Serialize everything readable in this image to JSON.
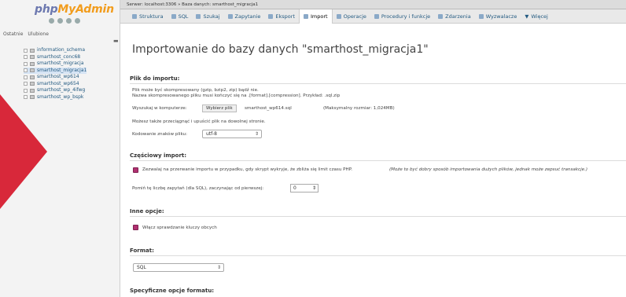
{
  "sidebar": {
    "logo_part1": "php",
    "logo_part2": "MyAdmin",
    "tabs": [
      "Ostatnie",
      "Ulubione"
    ],
    "databases": [
      "information_schema",
      "smarthost_conc68",
      "smarthost_migracja",
      "smarthost_migracja1",
      "smarthost_wp614",
      "smarthost_wp654",
      "smarthost_wp_4ifwg",
      "smarthost_wp_bspk"
    ]
  },
  "topbar": {
    "text": "Serwer: localhost:3306 » Baza danych: smarthost_migracja1"
  },
  "tabs": [
    "Struktura",
    "SQL",
    "Szukaj",
    "Zapytanie",
    "Eksport",
    "Import",
    "Operacje",
    "Procedury i funkcje",
    "Zdarzenia",
    "Wyzwalacze",
    "Więcej"
  ],
  "main": {
    "heading": "Importowanie do bazy danych \"smarthost_migracja1\"",
    "file_section": {
      "title": "Plik do importu:",
      "line1": "Plik może być skompresowany (gzip, bzip2, zip) bądź nie.",
      "line2": "Nazwa skompresowanego pliku musi kończyć się na .[format].[compression]. Przykład: .sql.zip",
      "browse_label": "Wyszukaj w komputerze:",
      "browse_button": "Wybierz plik",
      "file_name": "smarthost_wp614.sql",
      "max_size": "(Maksymalny rozmiar: 1,024MB)",
      "drag_hint": "Możesz także przeciągnąć i upuścić plik na dowolnej stronie.",
      "encoding_label": "Kodowanie znaków pliku:",
      "encoding_value": "utf-8"
    },
    "partial_section": {
      "title": "Częściowy import:",
      "interrupt_text": "Zezwalaj na przerwanie importu w przypadku, gdy skrypt wykryje, że zbliża się limit czasu PHP.",
      "interrupt_note": "(Może to być dobry sposób importowania dużych plików, jednak może zepsuć transakcje.)",
      "skip_label": "Pomiń tę liczbę zapytań (dla SQL), zaczynając od pierwszej:",
      "skip_value": "0"
    },
    "other_section": {
      "title": "Inne opcje:",
      "fk_label": "Włącz sprawdzanie kluczy obcych"
    },
    "format_section": {
      "title": "Format:",
      "format_value": "SQL"
    },
    "specific_section": {
      "title": "Specyficzne opcje formatu:"
    }
  }
}
